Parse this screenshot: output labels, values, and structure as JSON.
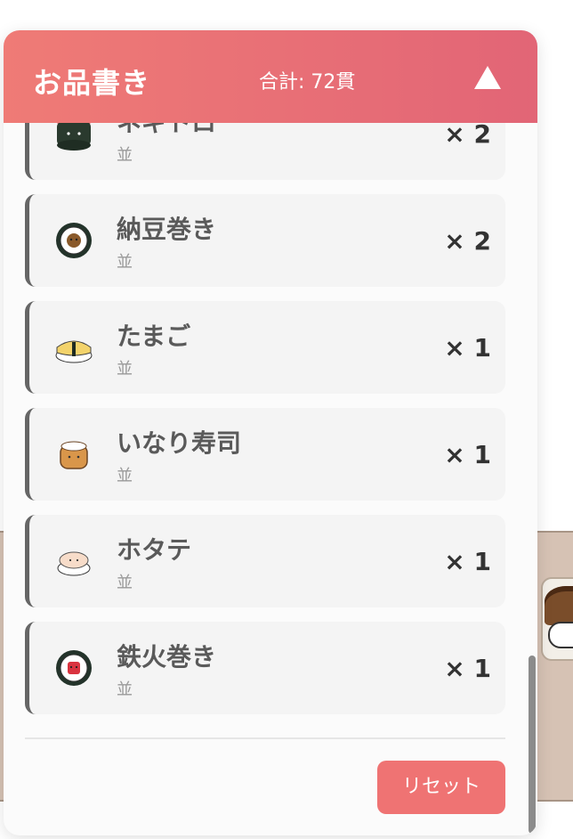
{
  "panel": {
    "title": "お品書き",
    "total": "合計: 72貫",
    "toggle_icon": "triangle-up-icon",
    "reset_label": "リセット"
  },
  "items": [
    {
      "name": "ネギトロ",
      "grade": "並",
      "qty": "× 2",
      "icon": "negitoro-gunkan-icon"
    },
    {
      "name": "納豆巻き",
      "grade": "並",
      "qty": "× 2",
      "icon": "natto-roll-icon"
    },
    {
      "name": "たまご",
      "grade": "並",
      "qty": "× 1",
      "icon": "tamago-sushi-icon"
    },
    {
      "name": "いなり寿司",
      "grade": "並",
      "qty": "× 1",
      "icon": "inari-sushi-icon"
    },
    {
      "name": "ホタテ",
      "grade": "並",
      "qty": "× 1",
      "icon": "hotate-sushi-icon"
    },
    {
      "name": "鉄火巻き",
      "grade": "並",
      "qty": "× 1",
      "icon": "tekka-roll-icon"
    }
  ],
  "colors": {
    "header_start": "#ef7b76",
    "header_end": "#e26576",
    "reset_button": "#ef7373",
    "card_border": "#666666"
  }
}
